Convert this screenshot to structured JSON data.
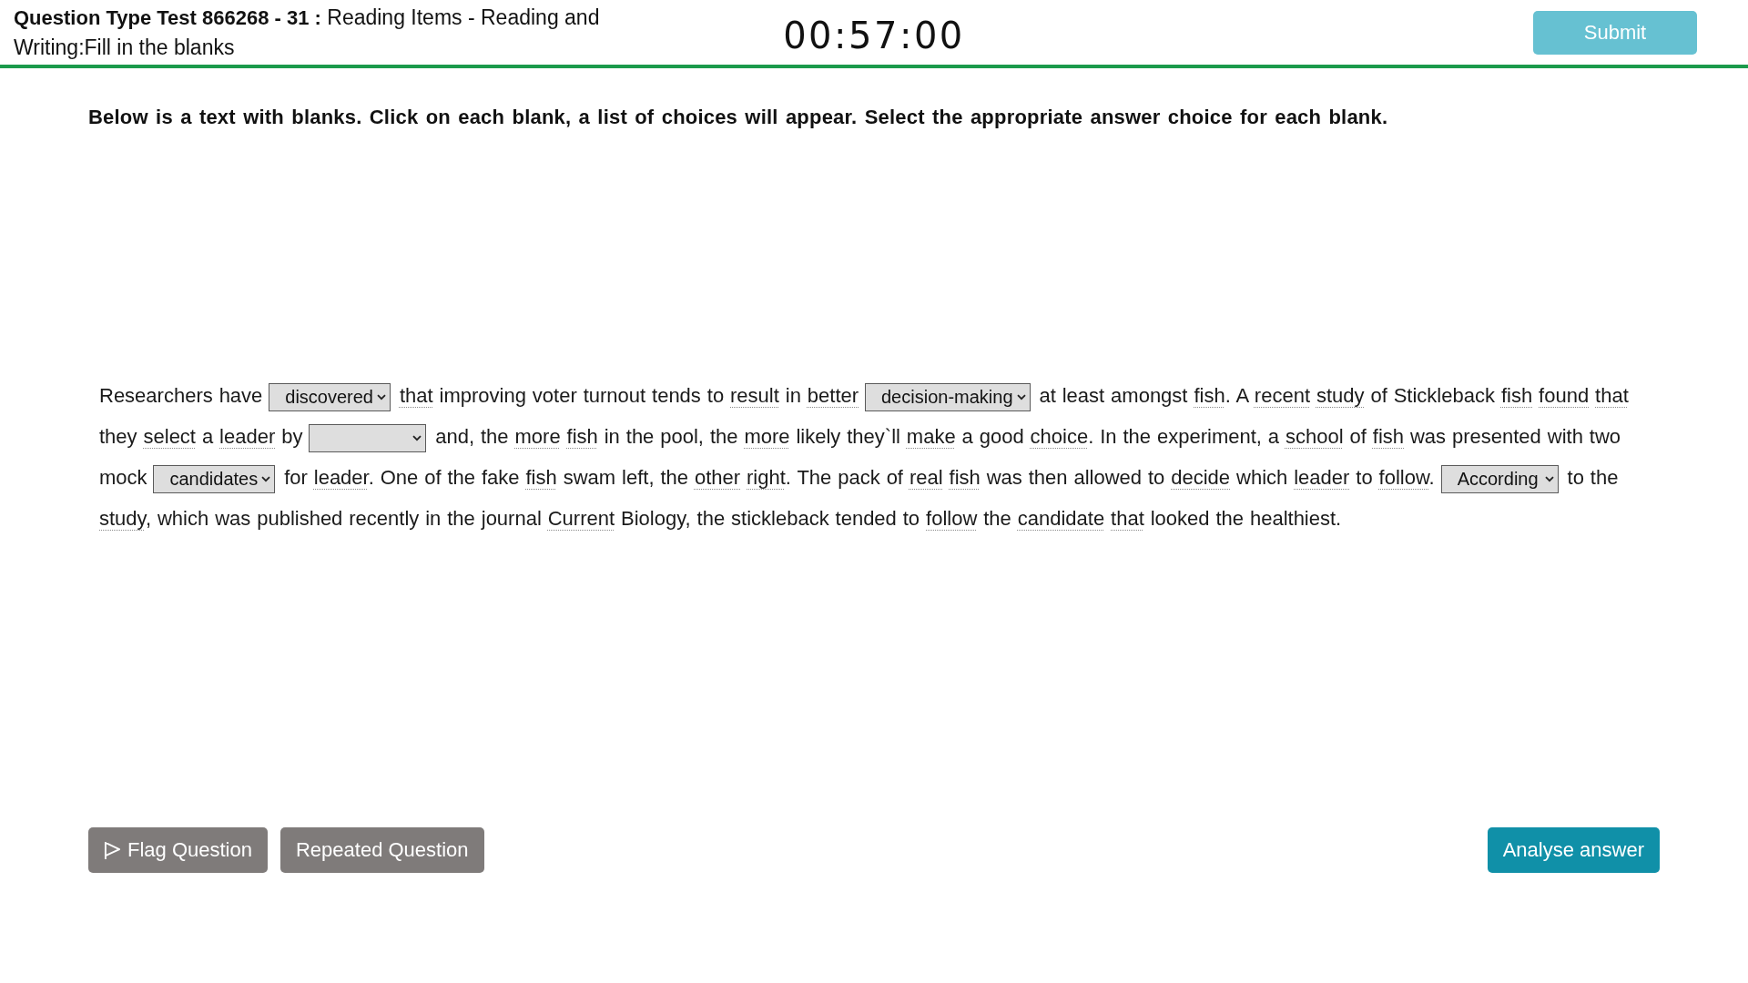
{
  "header": {
    "title": "**Question Type Test 866268 - 31 :** Reading Items - Reading and Writing:Fill in the blanks",
    "timer": "00:57:00",
    "submit_button": "Submit"
  },
  "instruction": "Below is a text with blanks. Click on each blank, a list of choices will appear. Select the appropriate answer choice for each blank.",
  "passage": [
    {
      "kind": "text",
      "text": "Researchers have"
    },
    {
      "kind": "blank",
      "value": "discovered"
    },
    {
      "kind": "word",
      "text": "that"
    },
    {
      "kind": "text",
      "text": "improving voter turnout tends to"
    },
    {
      "kind": "word",
      "text": "result"
    },
    {
      "kind": "text",
      "text": "in"
    },
    {
      "kind": "word",
      "text": "better"
    },
    {
      "kind": "blank",
      "value": "decision-making"
    },
    {
      "kind": "text",
      "text": "at least amongst"
    },
    {
      "kind": "word",
      "text": "fish"
    },
    {
      "kind": "text",
      "text": ". A"
    },
    {
      "kind": "word",
      "text": "recent"
    },
    {
      "kind": "word",
      "text": "study"
    },
    {
      "kind": "text",
      "text": "of Stickleback"
    },
    {
      "kind": "word",
      "text": "fish"
    },
    {
      "kind": "word",
      "text": "found"
    },
    {
      "kind": "word",
      "text": "that"
    },
    {
      "kind": "text",
      "text": "they"
    },
    {
      "kind": "word",
      "text": "select"
    },
    {
      "kind": "text",
      "text": "a"
    },
    {
      "kind": "word",
      "text": "leader"
    },
    {
      "kind": "text",
      "text": "by"
    },
    {
      "kind": "blank"
    },
    {
      "kind": "text",
      "text": "and, the"
    },
    {
      "kind": "word",
      "text": "more"
    },
    {
      "kind": "word",
      "text": "fish"
    },
    {
      "kind": "text",
      "text": "in the pool, the"
    },
    {
      "kind": "word",
      "text": "more"
    },
    {
      "kind": "text",
      "text": "likely they`ll"
    },
    {
      "kind": "word",
      "text": "make"
    },
    {
      "kind": "text",
      "text": "a good"
    },
    {
      "kind": "word",
      "text": "choice"
    },
    {
      "kind": "text",
      "text": ". In the experiment, a"
    },
    {
      "kind": "word",
      "text": "school"
    },
    {
      "kind": "text",
      "text": "of"
    },
    {
      "kind": "word",
      "text": "fish"
    },
    {
      "kind": "text",
      "text": "was presented with two mock"
    },
    {
      "kind": "blank",
      "value": "candidates"
    },
    {
      "kind": "text",
      "text": "for"
    },
    {
      "kind": "word",
      "text": "leader"
    },
    {
      "kind": "text",
      "text": ". One of the fake"
    },
    {
      "kind": "word",
      "text": "fish"
    },
    {
      "kind": "text",
      "text": "swam left, the"
    },
    {
      "kind": "word",
      "text": "other"
    },
    {
      "kind": "word",
      "text": "right"
    },
    {
      "kind": "text",
      "text": ". The pack of"
    },
    {
      "kind": "word",
      "text": "real"
    },
    {
      "kind": "word",
      "text": "fish"
    },
    {
      "kind": "text",
      "text": "was then allowed to"
    },
    {
      "kind": "word",
      "text": "decide"
    },
    {
      "kind": "text",
      "text": "which"
    },
    {
      "kind": "word",
      "text": "leader"
    },
    {
      "kind": "text",
      "text": "to"
    },
    {
      "kind": "word",
      "text": "follow"
    },
    {
      "kind": "text",
      "text": "."
    },
    {
      "kind": "blank",
      "value": "According"
    },
    {
      "kind": "text",
      "text": "to the"
    },
    {
      "kind": "word",
      "text": "study"
    },
    {
      "kind": "text",
      "text": ", which was published recently in the journal"
    },
    {
      "kind": "word",
      "text": "Current"
    },
    {
      "kind": "text",
      "text": "Biology, the stickleback tended to"
    },
    {
      "kind": "word",
      "text": "follow"
    },
    {
      "kind": "text",
      "text": "the"
    },
    {
      "kind": "word",
      "text": "candidate"
    },
    {
      "kind": "word",
      "text": "that"
    },
    {
      "kind": "text",
      "text": "looked the healthiest."
    }
  ],
  "footer": {
    "flag_button": "Flag Question",
    "repeated_button": "Repeated Question",
    "analyse_button": "Analyse answer"
  }
}
